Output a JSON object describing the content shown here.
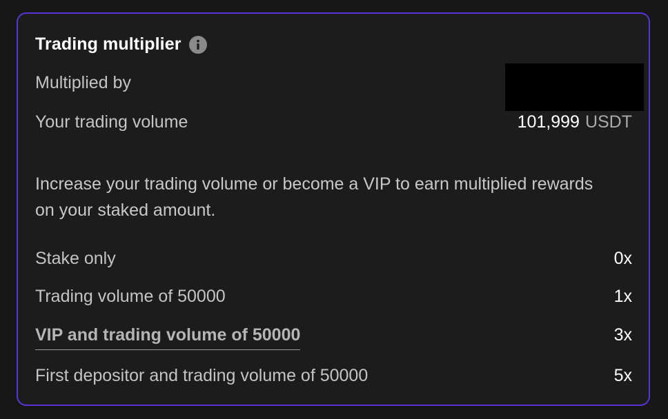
{
  "card": {
    "title": "Trading multiplier",
    "info_icon": "info-icon",
    "multiplied_by_label": "Multiplied by",
    "trading_volume_label": "Your trading volume",
    "trading_volume_value": "101,999",
    "trading_volume_unit": "USDT",
    "description": "Increase your trading volume or become a VIP to earn multiplied rewards on your staked amount.",
    "tiers": [
      {
        "label": "Stake only",
        "multiplier": "0x"
      },
      {
        "label": "Trading volume of 50000",
        "multiplier": "1x"
      },
      {
        "label": "VIP and trading volume of 50000",
        "multiplier": "3x"
      },
      {
        "label": "First depositor and trading volume of 50000",
        "multiplier": "5x"
      }
    ]
  },
  "colors": {
    "background": "#171717",
    "card_border": "#5b34d6",
    "redaction": "#000000"
  }
}
